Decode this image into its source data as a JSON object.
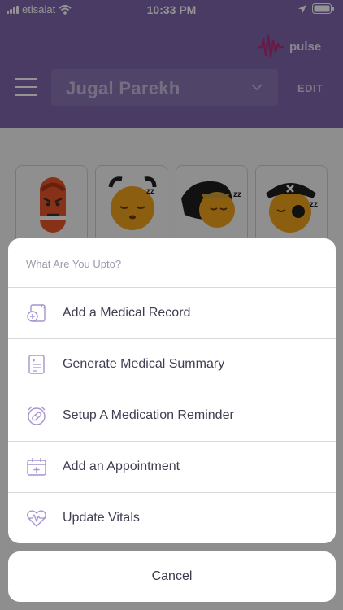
{
  "status_bar": {
    "carrier": "etisalat",
    "time": "10:33 PM"
  },
  "header": {
    "brand": "pulse",
    "profile_name": "Jugal Parekh",
    "edit_label": "EDIT"
  },
  "profile_avatars": [
    {
      "name": "angry-avatar"
    },
    {
      "name": "alarm-sleepy-avatar"
    },
    {
      "name": "hero-sleepy-avatar"
    },
    {
      "name": "pirate-sleepy-avatar"
    }
  ],
  "action_sheet": {
    "title": "What Are You Upto?",
    "actions": [
      {
        "label": "Add a Medical Record",
        "icon": "medical-record-icon"
      },
      {
        "label": "Generate Medical Summary",
        "icon": "summary-document-icon"
      },
      {
        "label": "Setup A Medication Reminder",
        "icon": "alarm-pill-icon"
      },
      {
        "label": "Add an Appointment",
        "icon": "calendar-add-icon"
      },
      {
        "label": "Update Vitals",
        "icon": "heart-pulse-icon"
      }
    ],
    "cancel_label": "Cancel"
  },
  "colors": {
    "header_purple": "#7e67ad",
    "icon_lilac": "#a693d0",
    "text_dark": "#3f3f52"
  }
}
